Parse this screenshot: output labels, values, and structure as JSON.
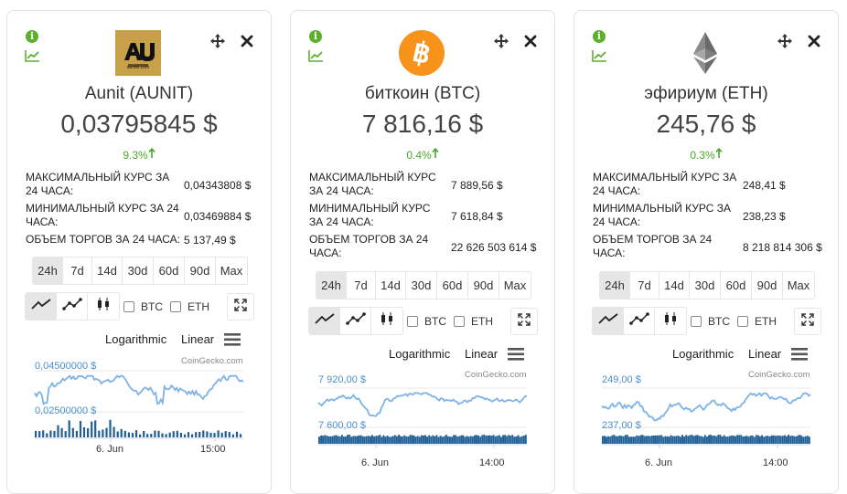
{
  "cards": [
    {
      "name": "Aunit (AUNIT)",
      "price": "0,03795845 $",
      "change": "9.3%",
      "logo": "aunit-logo",
      "logo_caption": "aunite.com",
      "stats": [
        {
          "label": "МАКСИМАЛЬНЫЙ КУРС ЗА 24 ЧАСА:",
          "value": "0,04343808 $"
        },
        {
          "label": "МИНИМАЛЬНЫЙ КУРС ЗА 24 ЧАСА:",
          "value": "0,03469884 $"
        },
        {
          "label": "ОБЪЕМ ТОРГОВ ЗА 24 ЧАСА:",
          "value": "5 137,49 $"
        }
      ],
      "chart": {
        "y_high": "0,04500000 $",
        "y_low": "0,02500000 $",
        "x_labels": [
          "6. Jun",
          "15:00"
        ]
      }
    },
    {
      "name": "биткоин (BTC)",
      "price": "7 816,16 $",
      "change": "0.4%",
      "logo": "bitcoin-logo",
      "logo_caption": "",
      "stats": [
        {
          "label": "МАКСИМАЛЬНЫЙ КУРС ЗА 24 ЧАСА:",
          "value": "7 889,56 $"
        },
        {
          "label": "МИНИМАЛЬНЫЙ КУРС ЗА 24 ЧАСА:",
          "value": "7 618,84 $"
        },
        {
          "label": "ОБЪЕМ ТОРГОВ ЗА 24 ЧАСА:",
          "value": "22 626 503 614 $"
        }
      ],
      "chart": {
        "y_high": "7 920,00 $",
        "y_low": "7 600,00 $",
        "x_labels": [
          "6. Jun",
          "14:00"
        ]
      }
    },
    {
      "name": "эфириум (ETH)",
      "price": "245,76 $",
      "change": "0.3%",
      "logo": "ethereum-logo",
      "logo_caption": "",
      "stats": [
        {
          "label": "МАКСИМАЛЬНЫЙ КУРС ЗА 24 ЧАСА:",
          "value": "248,41 $"
        },
        {
          "label": "МИНИМАЛЬНЫЙ КУРС ЗА 24 ЧАСА:",
          "value": "238,23 $"
        },
        {
          "label": "ОБЪЕМ ТОРГОВ ЗА 24 ЧАСА:",
          "value": "8 218 814 306 $"
        }
      ],
      "chart": {
        "y_high": "249,00 $",
        "y_low": "237,00 $",
        "x_labels": [
          "6. Jun",
          "14:00"
        ]
      }
    }
  ],
  "controls": {
    "periods": [
      "24h",
      "7d",
      "14d",
      "30d",
      "60d",
      "90d",
      "Max"
    ],
    "active_period": "24h",
    "compare": [
      "BTC",
      "ETH"
    ],
    "scale_log": "Logarithmic",
    "scale_linear": "Linear",
    "credit": "CoinGecko.com"
  },
  "colors": {
    "accent_green": "#4aa82a",
    "line_blue": "#7db3e8",
    "volume_blue": "#1f5f95",
    "bitcoin_orange": "#f7931a"
  }
}
